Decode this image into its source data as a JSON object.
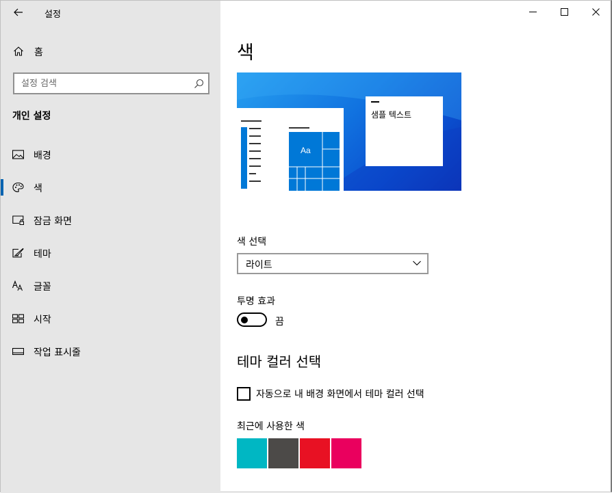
{
  "app": {
    "title": "설정"
  },
  "sidebar": {
    "home_label": "홈",
    "search_placeholder": "설정 검색",
    "section_title": "개인 설정",
    "items": [
      {
        "label": "배경",
        "icon": "picture-icon"
      },
      {
        "label": "색",
        "icon": "palette-icon",
        "active": true
      },
      {
        "label": "잠금 화면",
        "icon": "lock-screen-icon"
      },
      {
        "label": "테마",
        "icon": "theme-brush-icon"
      },
      {
        "label": "글꼴",
        "icon": "font-icon"
      },
      {
        "label": "시작",
        "icon": "start-icon"
      },
      {
        "label": "작업 표시줄",
        "icon": "taskbar-icon"
      }
    ]
  },
  "main": {
    "title": "색",
    "preview": {
      "sample_text": "샘플 텍스트",
      "tile_text": "Aa"
    },
    "color_choice": {
      "label": "색 선택",
      "value": "라이트"
    },
    "transparency": {
      "label": "투명 효과",
      "state": "끔",
      "on": false
    },
    "accent_heading": "테마 컬러 선택",
    "auto_accent": {
      "label": "자동으로 내 배경 화면에서 테마 컬러 선택",
      "checked": false
    },
    "recent": {
      "label": "최근에 사용한 색",
      "colors": [
        "#00b7c3",
        "#4c4a48",
        "#e81123",
        "#ea005e"
      ]
    }
  },
  "accent_color": "#0078d7"
}
